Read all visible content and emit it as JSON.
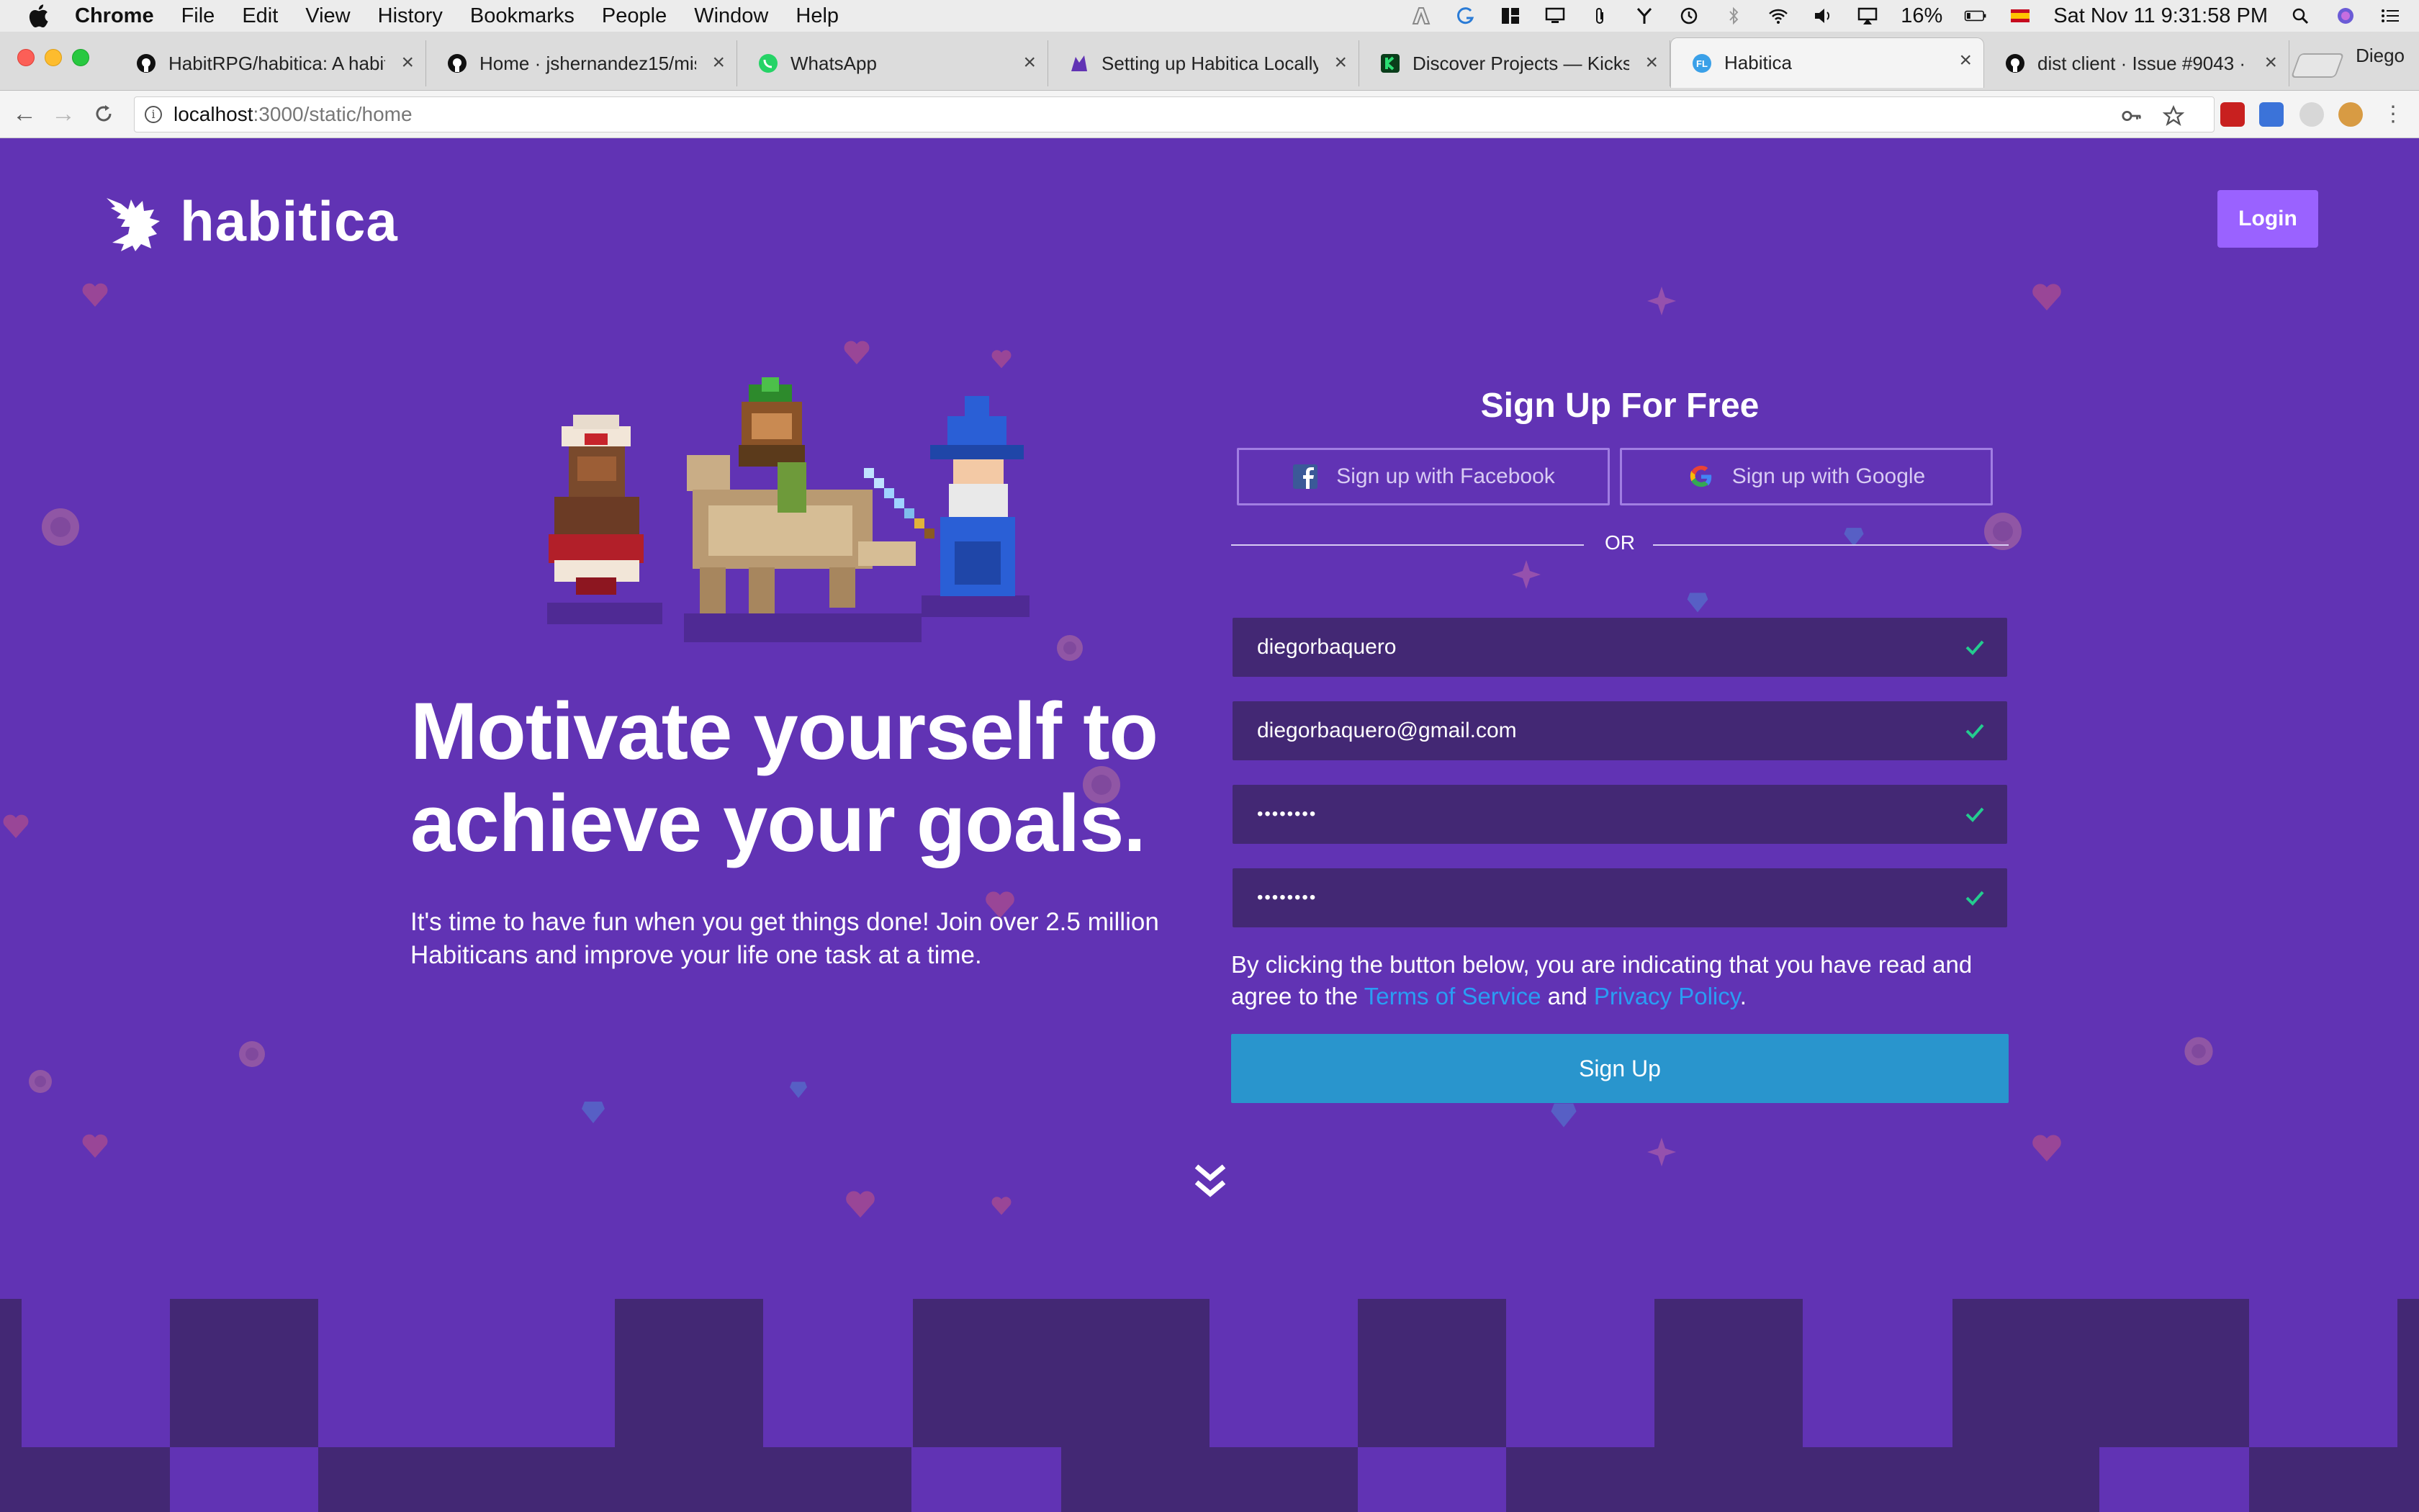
{
  "menubar": {
    "app": "Chrome",
    "items": [
      "File",
      "Edit",
      "View",
      "History",
      "Bookmarks",
      "People",
      "Window",
      "Help"
    ],
    "battery": "16%",
    "clock": "Sat Nov 11  9:31:58 PM"
  },
  "tabs": [
    {
      "title": "HabitRPG/habitica: A habit t",
      "icon": "github-icon"
    },
    {
      "title": "Home · jshernandez15/miso",
      "icon": "github-icon"
    },
    {
      "title": "WhatsApp",
      "icon": "whatsapp-icon"
    },
    {
      "title": "Setting up Habitica Locally |",
      "icon": "habitica-icon"
    },
    {
      "title": "Discover Projects — Kicksta",
      "icon": "kickstarter-icon"
    },
    {
      "title": "Habitica",
      "icon": "habitica-fl-icon"
    },
    {
      "title": "dist client · Issue #9043 · Ha",
      "icon": "github-icon"
    }
  ],
  "profile_name": "Diego",
  "url": {
    "host": "localhost",
    "path": ":3000/static/home"
  },
  "page": {
    "brand": "habitica",
    "login_label": "Login",
    "headline": "Motivate yourself to achieve your goals.",
    "subline": "It's time to have fun when you get things done! Join over 2.5 million Habiticans and improve your life one task at a time.",
    "signup_title": "Sign Up For Free",
    "facebook_label": "Sign up with Facebook",
    "google_label": "Sign up with Google",
    "or_label": "OR",
    "username": "diegorbaquero",
    "email": "diegorbaquero@gmail.com",
    "password_mask": "••••••••",
    "confirm_mask": "••••••••",
    "terms_prefix": "By clicking the button below, you are indicating that you have read and agree to the ",
    "terms_link": "Terms of Service",
    "terms_and": " and ",
    "privacy_link": "Privacy Policy",
    "terms_suffix": ".",
    "signup_label": "Sign Up"
  },
  "colors": {
    "page_bg": "#6133b4",
    "field_bg": "#432874",
    "login_bg": "#9a62ff",
    "signup_bg": "#2995cd",
    "link": "#2a9df4",
    "check": "#24cc8f"
  }
}
